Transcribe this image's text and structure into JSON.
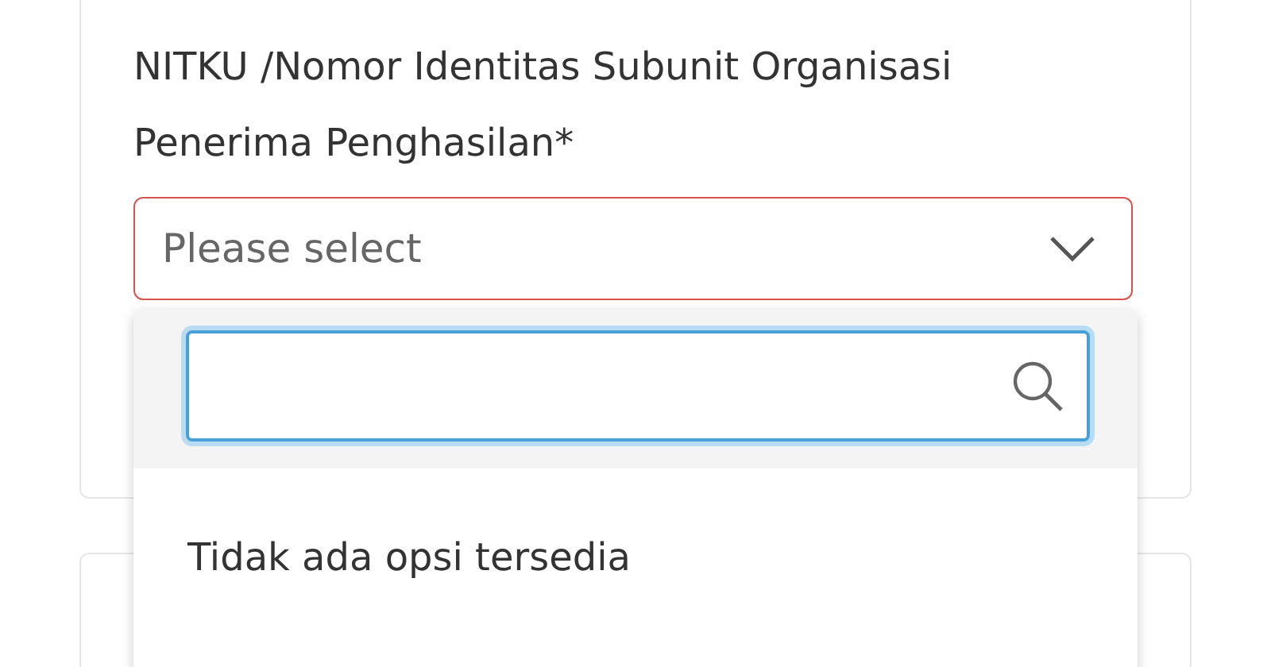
{
  "field": {
    "label": "NITKU /Nomor Identitas Subunit Organisasi Penerima Penghasilan*",
    "invalid": true,
    "select": {
      "placeholder": "Please select",
      "expanded": true
    }
  },
  "dropdown": {
    "empty_message": "Tidak ada opsi tersedia"
  }
}
